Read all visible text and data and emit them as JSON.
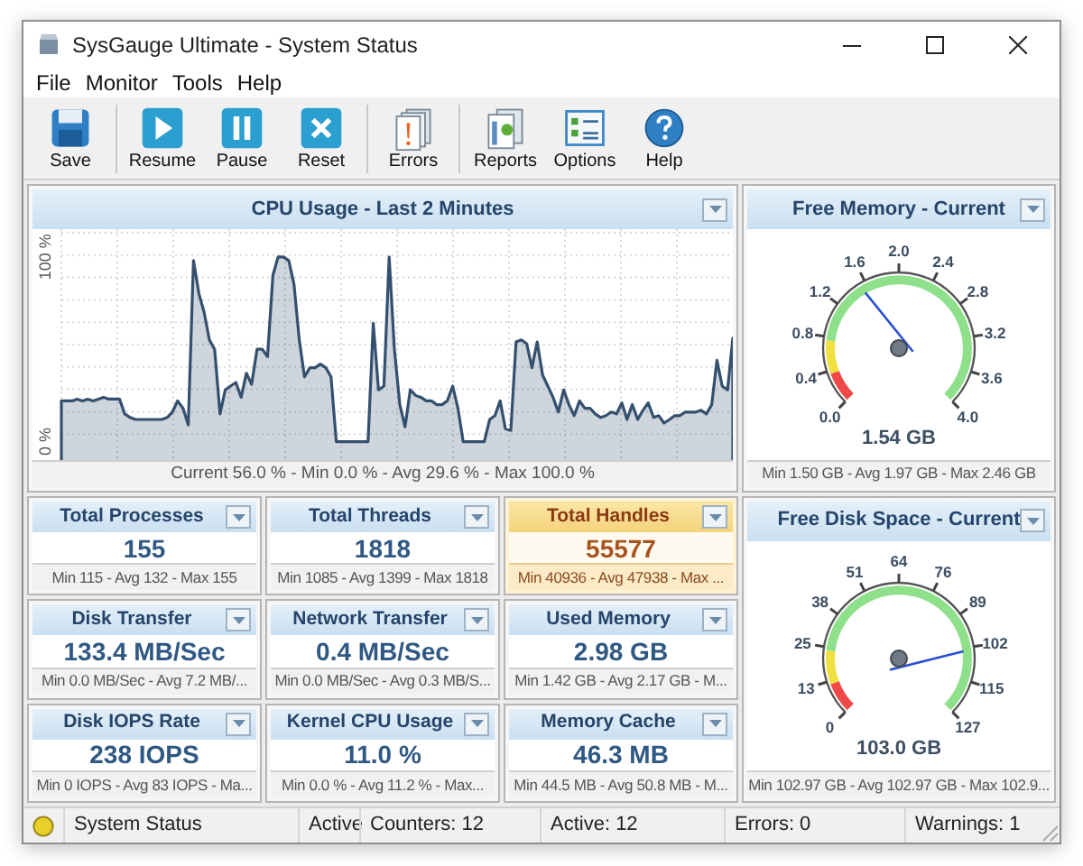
{
  "window": {
    "title": "SysGauge Ultimate - System Status"
  },
  "menu": [
    "File",
    "Monitor",
    "Tools",
    "Help"
  ],
  "toolbar": [
    [
      {
        "label": "Save",
        "kind": "save"
      }
    ],
    [
      {
        "label": "Resume",
        "kind": "play"
      },
      {
        "label": "Pause",
        "kind": "pause"
      },
      {
        "label": "Reset",
        "kind": "reset"
      }
    ],
    [
      {
        "label": "Errors",
        "kind": "errors"
      }
    ],
    [
      {
        "label": "Reports",
        "kind": "reports"
      },
      {
        "label": "Options",
        "kind": "options"
      },
      {
        "label": "Help",
        "kind": "help"
      }
    ]
  ],
  "cpu_panel": {
    "title": "CPU Usage - Last 2 Minutes",
    "summary": "Current 56.0 % - Min 0.0 % - Avg 29.6 % - Max 100.0 %",
    "chart_data": {
      "type": "area",
      "ylim": [
        -10,
        115
      ],
      "yticks": [
        {
          "value": 0,
          "label": "0 %"
        },
        {
          "value": 100,
          "label": "100 %"
        }
      ],
      "series": [
        {
          "color": "#34506e",
          "values": [
            22,
            22,
            22,
            23,
            22,
            23,
            22,
            23,
            24,
            23,
            23,
            23,
            15,
            13,
            12,
            12,
            12,
            12,
            12,
            12,
            13,
            16,
            22,
            18,
            9,
            98,
            80,
            70,
            55,
            50,
            15,
            28,
            30,
            32,
            24,
            37,
            31,
            50,
            50,
            46,
            90,
            100,
            100,
            98,
            85,
            55,
            35,
            40,
            40,
            42,
            40,
            35,
            0,
            0,
            0,
            0,
            0,
            0,
            0,
            64,
            28,
            30,
            100,
            50,
            20,
            8,
            28,
            25,
            24,
            22,
            22,
            20,
            20,
            22,
            30,
            18,
            0,
            0,
            0,
            0,
            0,
            12,
            14,
            22,
            7,
            6,
            54,
            55,
            53,
            40,
            54,
            36,
            30,
            24,
            16,
            28,
            20,
            14,
            22,
            18,
            18,
            15,
            13,
            14,
            16,
            15,
            21,
            12,
            20,
            12,
            17,
            21,
            13,
            14,
            10,
            12,
            14,
            14,
            16,
            16,
            16,
            17,
            15,
            20,
            44,
            30,
            28,
            56
          ]
        }
      ]
    }
  },
  "tiles": [
    {
      "title": "Total Processes",
      "value": "155",
      "summary": "Min 115 - Avg 132 - Max 155",
      "alert": false
    },
    {
      "title": "Total Threads",
      "value": "1818",
      "summary": "Min 1085 - Avg 1399 - Max 1818",
      "alert": false
    },
    {
      "title": "Total Handles",
      "value": "55577",
      "summary": "Min 40936 - Avg 47938 - Max ...",
      "alert": true
    },
    {
      "title": "Disk Transfer",
      "value": "133.4 MB/Sec",
      "summary": "Min 0.0 MB/Sec - Avg 7.2 MB/...",
      "alert": false
    },
    {
      "title": "Network Transfer",
      "value": "0.4 MB/Sec",
      "summary": "Min 0.0 MB/Sec - Avg 0.3 MB/S...",
      "alert": false
    },
    {
      "title": "Used Memory",
      "value": "2.98 GB",
      "summary": "Min 1.42 GB - Avg 2.17 GB - M...",
      "alert": false
    },
    {
      "title": "Disk IOPS Rate",
      "value": "238 IOPS",
      "summary": "Min 0 IOPS - Avg 83 IOPS - Ma...",
      "alert": false
    },
    {
      "title": "Kernel CPU Usage",
      "value": "11.0 %",
      "summary": "Min 0.0 % - Avg 11.2 % - Max...",
      "alert": false
    },
    {
      "title": "Memory Cache",
      "value": "46.3 MB",
      "summary": "Min 44.5 MB - Avg 50.8 MB - M...",
      "alert": false
    }
  ],
  "gauges": [
    {
      "title": "Free Memory - Current",
      "ticks": [
        "0.0",
        "0.4",
        "0.8",
        "1.2",
        "1.6",
        "2.0",
        "2.4",
        "2.8",
        "3.2",
        "3.6",
        "4.0"
      ],
      "value": "1.54 GB",
      "summary": "Min 1.50 GB - Avg 1.97 GB - Max 2.46 GB"
    },
    {
      "title": "Free Disk Space - Current",
      "ticks": [
        "0",
        "13",
        "25",
        "38",
        "51",
        "64",
        "76",
        "89",
        "102",
        "115",
        "127"
      ],
      "value": "103.0 GB",
      "summary": "Min 102.97 GB - Avg 102.97 GB - Max 102.9..."
    }
  ],
  "status_bar": [
    "System Status",
    "Active",
    "Counters: 12",
    "Active: 12",
    "Errors: 0",
    "Warnings: 1"
  ]
}
